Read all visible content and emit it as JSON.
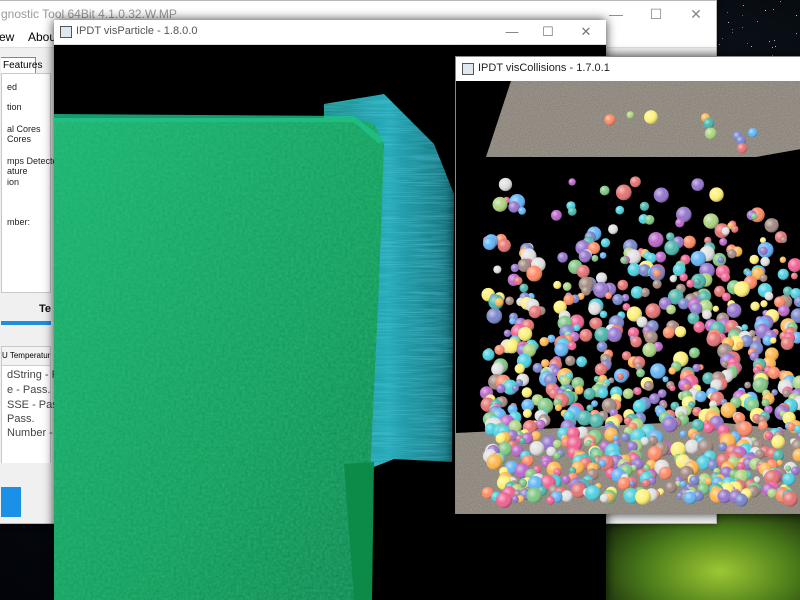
{
  "diagnostic_tool": {
    "title": "gnostic Tool 64Bit 4.1.0.32.W.MP",
    "menu": [
      "ew",
      "About"
    ],
    "tab_label": "Features",
    "features": [
      "ed",
      "tion",
      "al Cores",
      "Cores",
      "mps Detected",
      "ature",
      "ion",
      "mber:"
    ],
    "section_label": "Te",
    "cpu_header": "U Temperature",
    "log_lines": [
      "dString - Pa",
      "e - Pass.",
      "SSE - Pass",
      "Pass.",
      "Number -"
    ],
    "ctrl_minimize": "—",
    "ctrl_maximize": "☐",
    "ctrl_close": "✕"
  },
  "vis_particle": {
    "title": "IPDT visParticle - 1.8.0.0",
    "ctrl_minimize": "—",
    "ctrl_maximize": "☐",
    "ctrl_close": "✕",
    "colors": {
      "front": "#12a560",
      "side": "#1d9fb0",
      "background": "#000000"
    }
  },
  "vis_collisions": {
    "title": "IPDT visCollisions - 1.7.0.1",
    "colors": {
      "plane": "#8d8478",
      "background": "#000000"
    }
  }
}
